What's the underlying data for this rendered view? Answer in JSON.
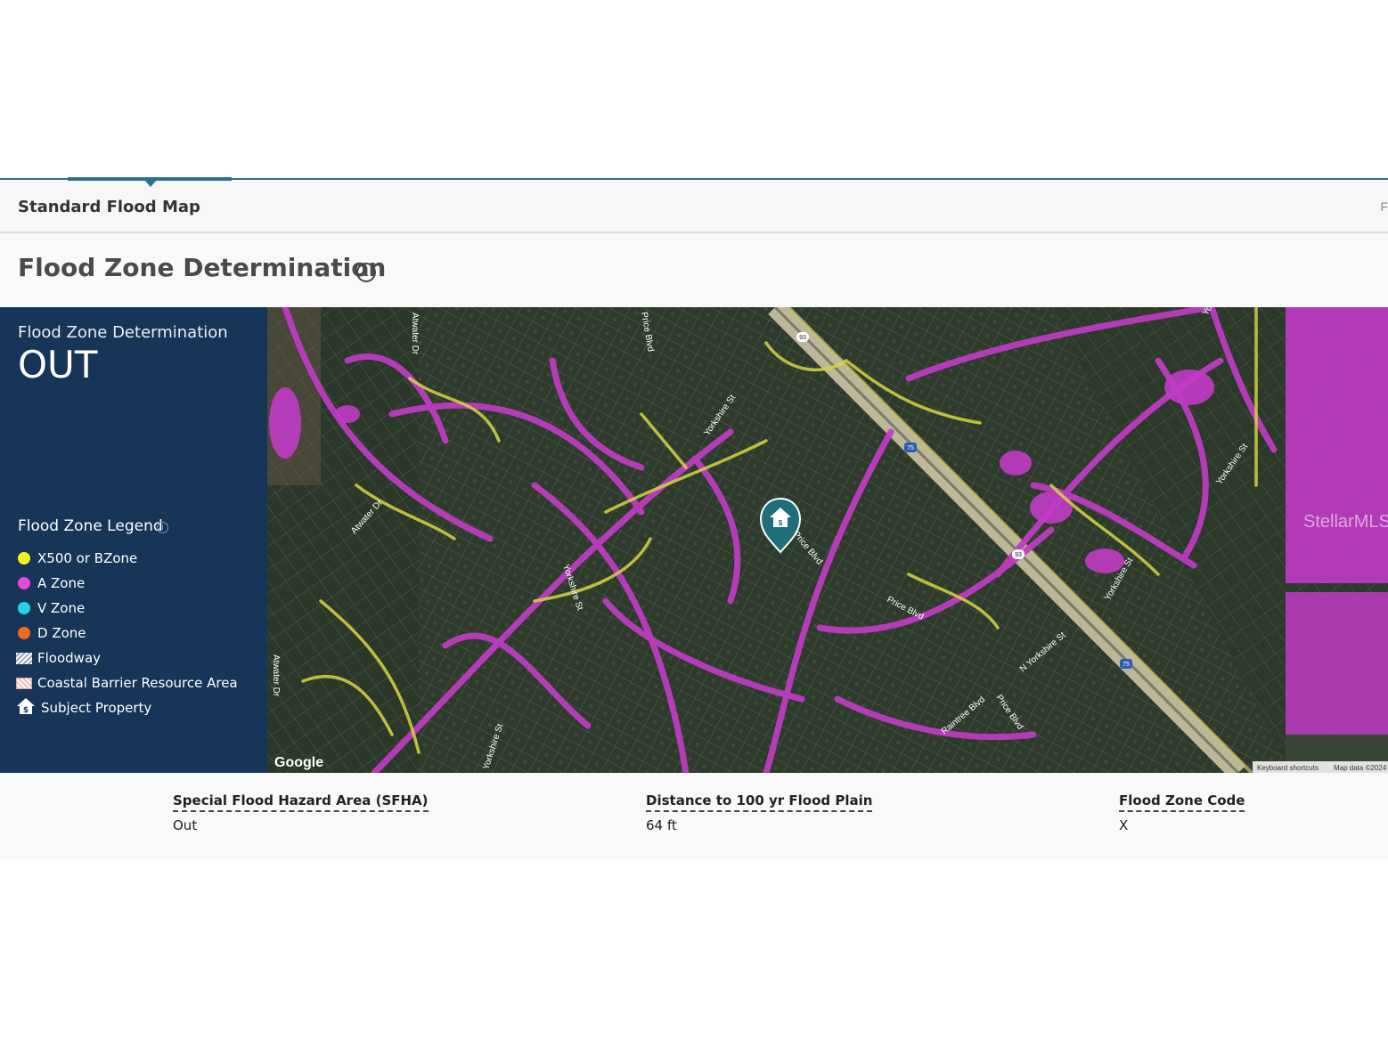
{
  "tabs": {
    "active_label": "Standard Flood Map",
    "edge_label": "F"
  },
  "heading": {
    "title": "Flood Zone Determination",
    "info_icon": "info-icon"
  },
  "panel": {
    "determination_label": "Flood Zone Determination",
    "determination_value": "OUT",
    "legend_title": "Flood Zone Legend",
    "legend": [
      {
        "label": "X500 or BZone",
        "color": "#f5f21e",
        "type": "dot"
      },
      {
        "label": "A Zone",
        "color": "#e04bd9",
        "type": "dot"
      },
      {
        "label": "V Zone",
        "color": "#22d6e6",
        "type": "dot"
      },
      {
        "label": "D Zone",
        "color": "#f06a1c",
        "type": "dot"
      },
      {
        "label": "Floodway",
        "type": "hatch"
      },
      {
        "label": "Coastal Barrier Resource Area",
        "type": "crosshatch"
      },
      {
        "label": "Subject Property",
        "type": "house-icon"
      }
    ]
  },
  "map": {
    "streets": [
      "Atwater Dr",
      "Atwater Dr",
      "Atwater Dr",
      "Price Blvd",
      "Yorkshire St",
      "Yorkshire St",
      "Yorkshire St",
      "Yorkshire St",
      "Price Blvd",
      "Price Blvd",
      "N Yorkshire St",
      "Raintree Blvd",
      "Price Blvd",
      "Yorkshire St",
      "Yorkshire St"
    ],
    "shields": [
      "93",
      "75",
      "93",
      "75"
    ],
    "provider": "Google",
    "watermark": "StellarMLS",
    "footer_links": [
      "Keyboard shortcuts",
      "Map data ©2024"
    ],
    "marker_icon": "house-dollar-icon",
    "colors": {
      "a_zone": "#c13bc6",
      "x500": "#d6d640",
      "vegetation": "#2f3d2c"
    }
  },
  "info": [
    {
      "label": "Special Flood Hazard Area (SFHA)",
      "value": "Out"
    },
    {
      "label": "Distance to 100 yr Flood Plain",
      "value": "64 ft"
    },
    {
      "label": "Flood Zone Code",
      "value": "X"
    }
  ]
}
